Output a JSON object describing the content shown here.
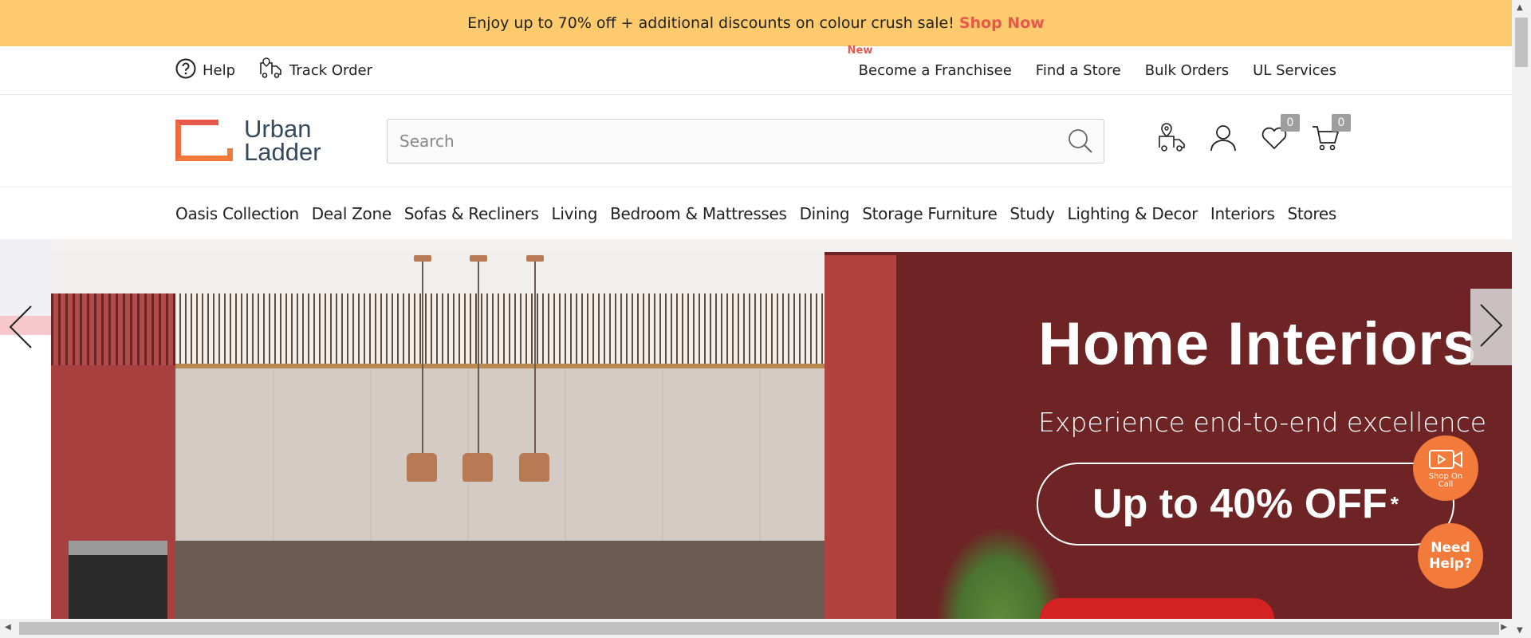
{
  "promo": {
    "text": "Enjoy up to 70% off + additional discounts on colour crush sale!",
    "cta": "Shop Now"
  },
  "utility": {
    "help": "Help",
    "track_order": "Track Order",
    "new_badge": "New",
    "links": [
      "Become a Franchisee",
      "Find a Store",
      "Bulk Orders",
      "UL Services"
    ]
  },
  "logo": {
    "line1": "Urban",
    "line2": "Ladder"
  },
  "search": {
    "placeholder": "Search"
  },
  "header_icons": {
    "wishlist_count": "0",
    "cart_count": "0"
  },
  "nav": {
    "items": [
      "Oasis Collection",
      "Deal Zone",
      "Sofas & Recliners",
      "Living",
      "Bedroom & Mattresses",
      "Dining",
      "Storage Furniture",
      "Study",
      "Lighting & Decor",
      "Interiors",
      "Stores"
    ]
  },
  "hero": {
    "title": "Home Interiors",
    "subtitle": "Experience end-to-end excellence",
    "offer": "Up to 40% OFF",
    "offer_mark": "*"
  },
  "fab": {
    "call_line1": "Shop On",
    "call_line2": "Call",
    "help_line1": "Need",
    "help_line2": "Help?"
  },
  "colors": {
    "promo_bg": "#fdcb6e",
    "accent": "#e8584a",
    "fab": "#f27a3a",
    "brand_text": "#34495e"
  }
}
